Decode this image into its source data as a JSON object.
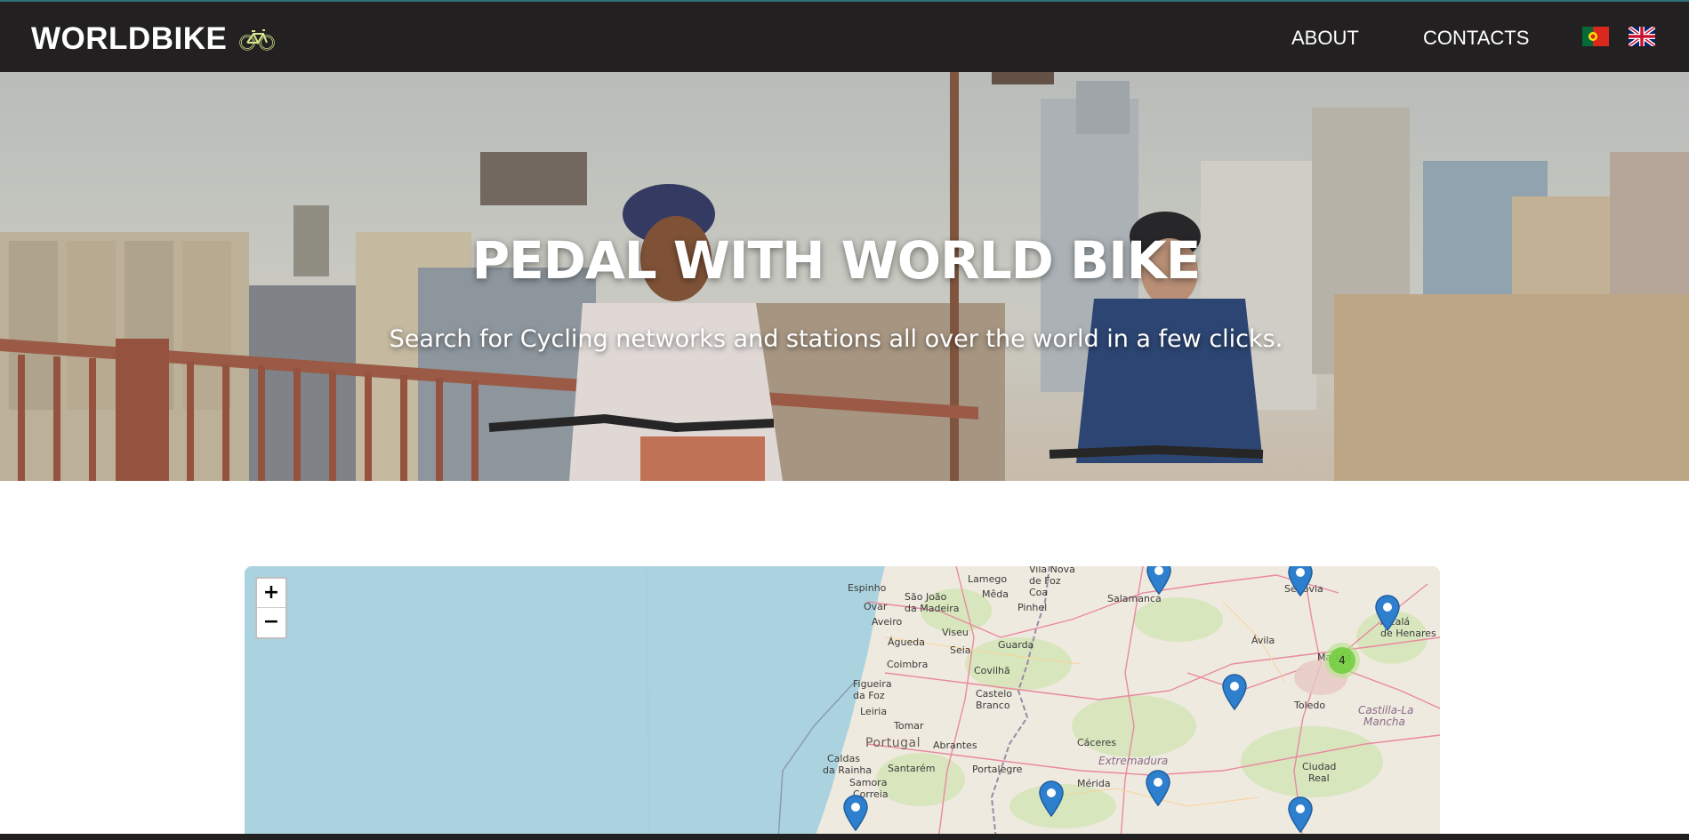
{
  "navbar": {
    "brand": "WORLDBIKE",
    "brand_icon": "bicycle-icon",
    "links": [
      {
        "label": "ABOUT"
      },
      {
        "label": "CONTACTS"
      }
    ],
    "languages": [
      {
        "icon": "portugal-flag-icon"
      },
      {
        "icon": "uk-flag-icon"
      }
    ],
    "background": "#222021"
  },
  "hero": {
    "title": "PEDAL WITH WORLD BIKE",
    "subtitle": "Search for Cycling networks and stations all over the world in a few clicks."
  },
  "map": {
    "zoom_in_label": "+",
    "zoom_out_label": "−",
    "labels": {
      "espinho": "Espinho",
      "sjoao": "São João",
      "damadeira": "da Madeira",
      "lamego": "Lamego",
      "villanova": "Vila Nova",
      "defoz": "de Foz",
      "coa": "Coa",
      "meda": "Mêda",
      "pinhel": "Pinhel",
      "ovar": "Ovar",
      "aveiro": "Aveiro",
      "viseu": "Viseu",
      "agueda": "Águeda",
      "seia": "Seia",
      "guarda": "Guarda",
      "coimbra": "Coimbra",
      "covilha": "Covilhã",
      "figueira": "Figueira",
      "dafoz": "da Foz",
      "castelo": "Castelo",
      "branco": "Branco",
      "leiria": "Leiria",
      "tomar": "Tomar",
      "portugal": "Portugal",
      "abrantes": "Abrantes",
      "caldas": "Caldas",
      "darainha": "da Rainha",
      "santarem": "Santarém",
      "portalegre": "Portalegre",
      "samora": "Samora",
      "correia": "Correia",
      "salamanca": "Salamanca",
      "segovia": "Segovia",
      "avila": "Ávila",
      "alcala": "Alcalá",
      "deheneres": "de Henares",
      "madrid": "Madrid",
      "toledo": "Toledo",
      "castilla": "Castilla-La",
      "mancha": "Mancha",
      "caceres": "Cáceres",
      "extremadura": "Extremadura",
      "merida": "Mérida",
      "ciudad": "Ciudad",
      "real": "Real"
    },
    "markers": [
      {
        "icon": "map-pin-icon"
      },
      {
        "icon": "map-pin-icon"
      },
      {
        "icon": "map-pin-icon"
      },
      {
        "icon": "map-pin-icon"
      },
      {
        "icon": "map-pin-icon"
      },
      {
        "icon": "map-pin-icon"
      },
      {
        "icon": "map-pin-icon"
      },
      {
        "icon": "map-pin-icon"
      }
    ],
    "cluster": {
      "count": "4"
    }
  }
}
